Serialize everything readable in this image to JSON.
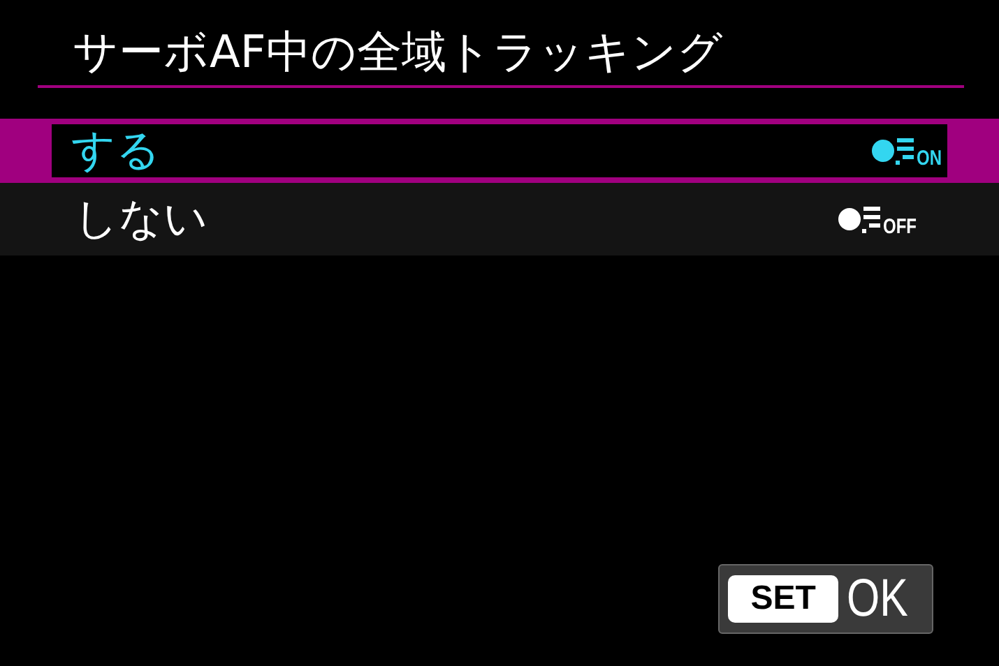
{
  "title": "サーボAF中の全域トラッキング",
  "options": [
    {
      "label": "する",
      "indicator": "ON",
      "selected": true
    },
    {
      "label": "しない",
      "indicator": "OFF",
      "selected": false
    }
  ],
  "footer": {
    "key": "SET",
    "action": "OK"
  }
}
